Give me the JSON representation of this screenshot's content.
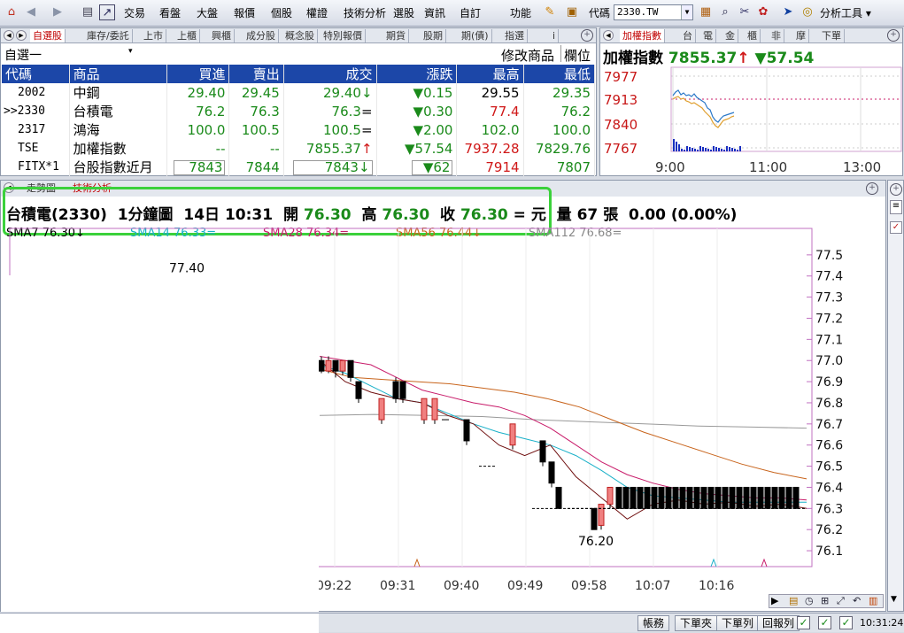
{
  "toolbar": {
    "menus": [
      "交易",
      "看盤",
      "大盤",
      "報價",
      "個股",
      "權證",
      "技術分析",
      "選股",
      "資訊",
      "自訂",
      "功能"
    ],
    "code_label": "代碼",
    "code_value": "2330.TW",
    "analysis_tools": "分析工具"
  },
  "watchlist": {
    "tabs": [
      "自選股",
      "庫存/委託",
      "上市",
      "上櫃",
      "興櫃",
      "成分股",
      "概念股",
      "特別報價",
      "期貨",
      "股期",
      "期(債)",
      "指選",
      "i"
    ],
    "active_tab": "自選股",
    "list_name": "自選一",
    "edit_label": "修改商品",
    "field_label": "欄位",
    "columns": [
      "代碼",
      "商品",
      "買進",
      "賣出",
      "成交",
      "漲跌",
      "最高",
      "最低"
    ],
    "rows": [
      {
        "code": "2002",
        "name": "中鋼",
        "bid": "29.40",
        "ask": "29.45",
        "last": "29.40",
        "last_mark": "↓",
        "chg": "0.15",
        "chg_mark": "▼",
        "high": "29.55",
        "low": "29.35",
        "color": "#1a8a1a",
        "high_color": "#000000",
        "low_color": "#1a8a1a",
        "boxed": false
      },
      {
        "code": ">>2330",
        "name": "台積電",
        "bid": "76.2",
        "ask": "76.3",
        "last": "76.3",
        "last_mark": "=",
        "chg": "0.30",
        "chg_mark": "▼",
        "high": "77.4",
        "low": "76.2",
        "color": "#1a8a1a",
        "high_color": "#d01818",
        "low_color": "#1a8a1a",
        "boxed": false
      },
      {
        "code": "2317",
        "name": "鴻海",
        "bid": "100.0",
        "ask": "100.5",
        "last": "100.5",
        "last_mark": "=",
        "chg": "2.00",
        "chg_mark": "▼",
        "high": "102.0",
        "low": "100.0",
        "color": "#1a8a1a",
        "high_color": "#1a8a1a",
        "low_color": "#1a8a1a",
        "boxed": false
      },
      {
        "code": "TSE",
        "name": "加權指數",
        "bid": "--",
        "ask": "--",
        "last": "7855.37",
        "last_mark": "↑",
        "chg": "57.54",
        "chg_mark": "▼",
        "high": "7937.28",
        "low": "7829.76",
        "color": "#1a8a1a",
        "high_color": "#d01818",
        "low_color": "#1a8a1a",
        "boxed": false
      },
      {
        "code": "FITX*1",
        "name": "台股指數近月",
        "bid": "7843",
        "ask": "7844",
        "last": "7843",
        "last_mark": "↓",
        "chg": "62",
        "chg_mark": "▼",
        "high": "7914",
        "low": "7807",
        "color": "#1a8a1a",
        "high_color": "#d01818",
        "low_color": "#1a8a1a",
        "boxed": true
      }
    ]
  },
  "index_panel": {
    "tabs": [
      "加權指數",
      "台",
      "電",
      "金",
      "櫃",
      "非",
      "摩",
      "下單"
    ],
    "title": "加權指數",
    "value": "7855.37",
    "up_mark": "↑",
    "change": "▼57.54",
    "y_labels": [
      "7977",
      "7913",
      "7840",
      "7767"
    ],
    "x_labels": [
      "9:00",
      "11:00",
      "13:00"
    ]
  },
  "tech_panel": {
    "tabs": [
      "走勢圖",
      "技術分析"
    ],
    "stock": "台積電(2330)",
    "period": "1分鐘圖",
    "date_time": "14日 10:31",
    "open_label": "開",
    "open": "76.30",
    "high_label": "高",
    "high": "76.30",
    "close_label": "收",
    "close": "76.30",
    "close_mark": "=",
    "unit": "元",
    "vol_label": "量",
    "vol": "67",
    "vol_unit": "張",
    "change": "0.00 (0.00%)",
    "sma": [
      {
        "label": "SMA7 76.30",
        "mark": "↓",
        "color": "#000000"
      },
      {
        "label": "SMA14 76.33",
        "mark": "=",
        "color": "#19b0c8"
      },
      {
        "label": "SMA28 76.34",
        "mark": "=",
        "color": "#c81c6a"
      },
      {
        "label": "SMA56 76.44",
        "mark": "↓",
        "color": "#c8641c"
      },
      {
        "label": "SMA112 76.68",
        "mark": "=",
        "color": "#888888"
      }
    ],
    "peak_label": "77.40",
    "low_label": "76.20"
  },
  "chart_data": {
    "type": "candlestick",
    "ylim": [
      76.05,
      77.6
    ],
    "yticks": [
      "77.5",
      "77.4",
      "77.3",
      "77.2",
      "77.1",
      "77.0",
      "76.9",
      "76.8",
      "76.7",
      "76.6",
      "76.5",
      "76.4",
      "76.3",
      "76.2",
      "76.1"
    ],
    "xticks": [
      "09:22",
      "09:31",
      "09:40",
      "09:49",
      "09:58",
      "10:07",
      "10:16"
    ]
  },
  "status": {
    "buttons": [
      "帳務",
      "下單夾",
      "下單列",
      "回報列"
    ],
    "time": "10:31:24"
  }
}
